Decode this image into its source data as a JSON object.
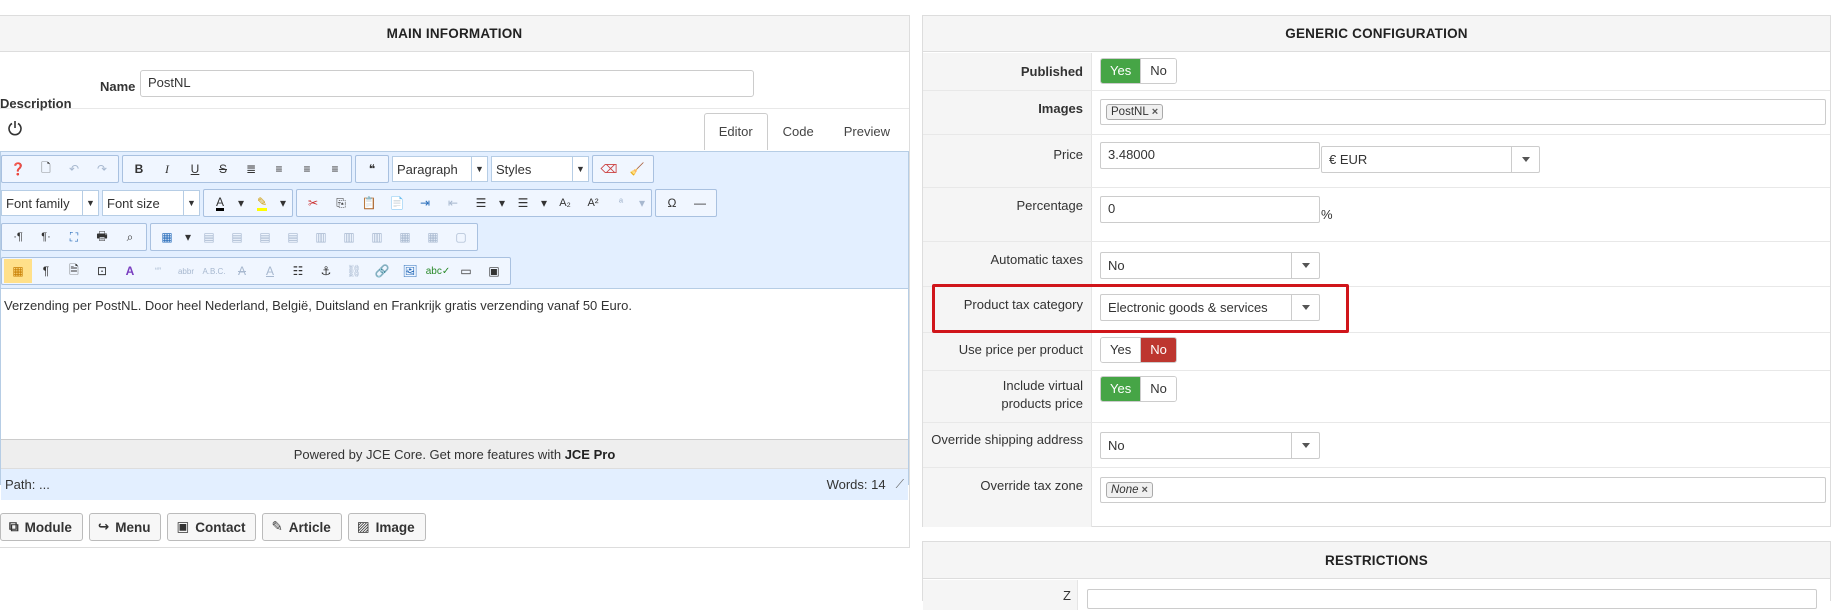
{
  "main": {
    "title": "MAIN INFORMATION",
    "name_label": "Name",
    "name_value": "PostNL",
    "description_label": "Description",
    "tabs": [
      {
        "label": "Editor"
      },
      {
        "label": "Code"
      },
      {
        "label": "Preview"
      }
    ],
    "toolbar": {
      "paragraph_select": "Paragraph",
      "styles_select": "Styles",
      "font_family_select": "Font family",
      "font_size_select": "Font size"
    },
    "content_text": "Verzending per PostNL. Door heel Nederland, België, Duitsland en Frankrijk gratis verzending vanaf 50 Euro.",
    "powered_prefix": "Powered by JCE Core. Get more features with",
    "powered_brand": "JCE Pro",
    "path_label": "Path:",
    "path_value": "...",
    "words_label": "Words: 14",
    "buttons": [
      {
        "label": "Module"
      },
      {
        "label": "Menu"
      },
      {
        "label": "Contact"
      },
      {
        "label": "Article"
      },
      {
        "label": "Image"
      }
    ]
  },
  "generic": {
    "title": "GENERIC CONFIGURATION",
    "published_label": "Published",
    "yes": "Yes",
    "no": "No",
    "images_label": "Images",
    "images_tag": "PostNL",
    "price_label": "Price",
    "price_value": "3.48000",
    "currency_value": "€ EUR",
    "percentage_label": "Percentage",
    "percentage_value": "0",
    "percent_sign": "%",
    "automatic_taxes_label": "Automatic taxes",
    "automatic_taxes_value": "No",
    "product_tax_category_label": "Product tax category",
    "product_tax_category_value": "Electronic goods & services",
    "use_price_per_product_label": "Use price per product",
    "include_virtual_label_1": "Include virtual",
    "include_virtual_label_2": "products price",
    "override_shipping_label": "Override shipping address",
    "override_shipping_value": "No",
    "override_tax_zone_label": "Override tax zone",
    "override_tax_zone_tag": "None"
  },
  "restrictions": {
    "title": "RESTRICTIONS",
    "first_label": "Z"
  },
  "colors": {
    "yes_active": "#46a546",
    "no_active": "#bd362f",
    "highlight": "#d0151a",
    "toolbar_bg": "#e3efff"
  }
}
